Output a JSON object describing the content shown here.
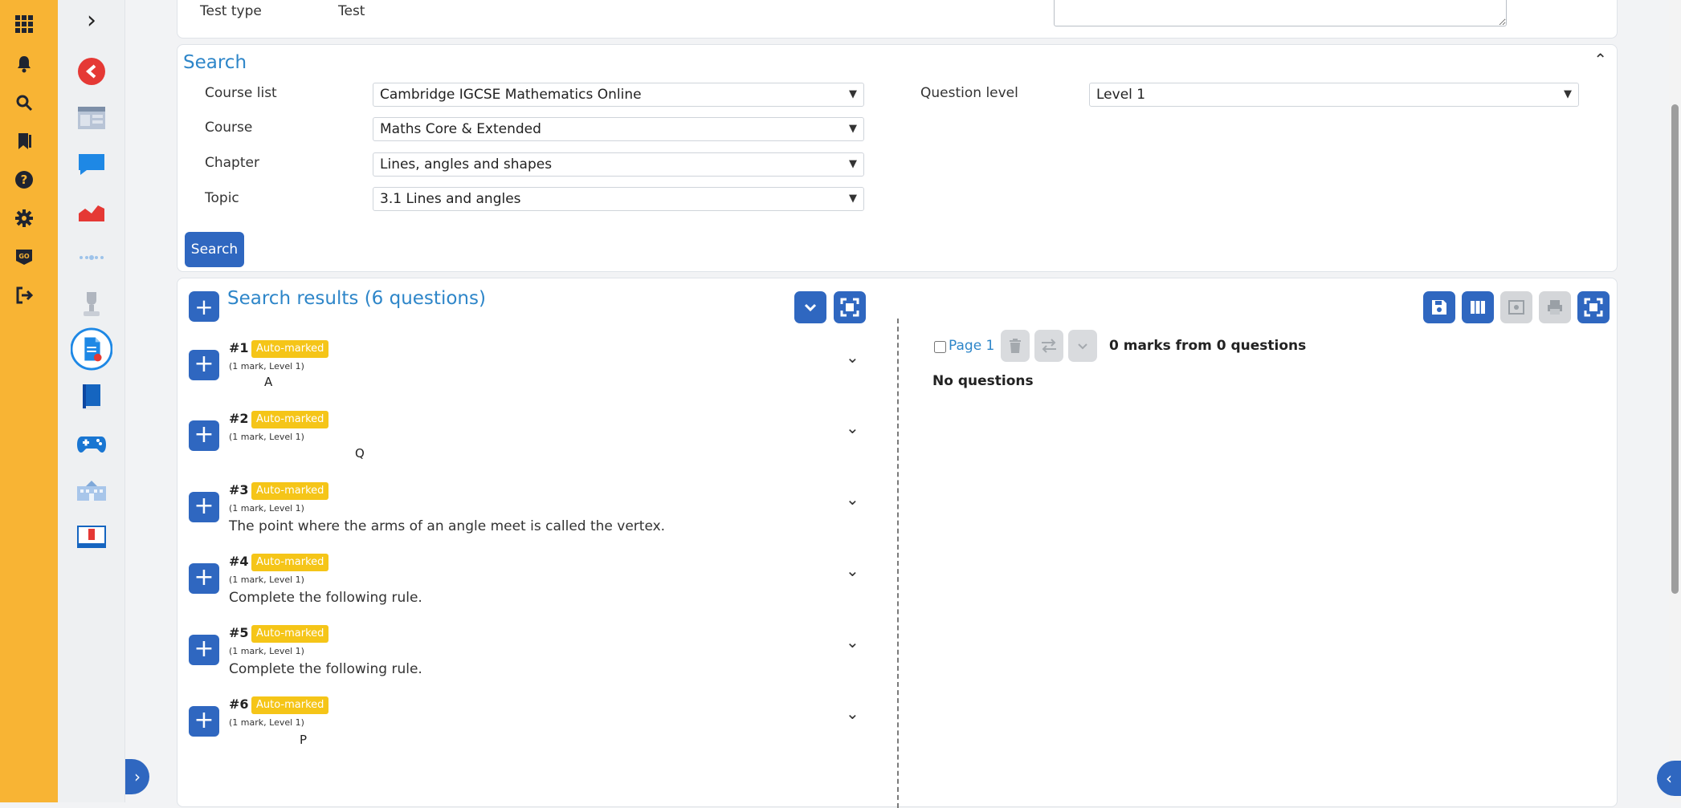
{
  "rail": {
    "icons": [
      "apps-grid-icon",
      "bell-icon",
      "search-icon",
      "bookmark-icon",
      "help-icon",
      "gear-icon",
      "go-icon",
      "logout-icon"
    ]
  },
  "nav2": {
    "icons": [
      "back-icon",
      "dashboard-icon",
      "chat-icon",
      "chart-icon",
      "progress-icon",
      "trophy-icon",
      "document-icon",
      "book-icon",
      "gamepad-icon",
      "school-icon",
      "id-card-icon"
    ]
  },
  "top": {
    "test_type_label": "Test type",
    "test_type_value": "Test"
  },
  "search": {
    "title": "Search",
    "course_list_label": "Course list",
    "course_list_value": "Cambridge IGCSE Mathematics Online",
    "course_label": "Course",
    "course_value": "Maths Core & Extended",
    "chapter_label": "Chapter",
    "chapter_value": "Lines, angles and shapes",
    "topic_label": "Topic",
    "topic_value": "3.1 Lines and angles",
    "question_level_label": "Question level",
    "question_level_value": "Level 1",
    "button": "Search"
  },
  "results": {
    "title": "Search results (6 questions)",
    "questions": [
      {
        "num": "#1",
        "badge": "Auto-marked",
        "meta": "(1 mark, Level 1)",
        "text": "",
        "glyph": "A"
      },
      {
        "num": "#2",
        "badge": "Auto-marked",
        "meta": "(1 mark, Level 1)",
        "text": "",
        "glyph": "Q"
      },
      {
        "num": "#3",
        "badge": "Auto-marked",
        "meta": "(1 mark, Level 1)",
        "text": "The point where the arms of an angle meet is called the vertex.",
        "glyph": ""
      },
      {
        "num": "#4",
        "badge": "Auto-marked",
        "meta": "(1 mark, Level 1)",
        "text": "Complete the following rule.",
        "glyph": ""
      },
      {
        "num": "#5",
        "badge": "Auto-marked",
        "meta": "(1 mark, Level 1)",
        "text": "Complete the following rule.",
        "glyph": ""
      },
      {
        "num": "#6",
        "badge": "Auto-marked",
        "meta": "(1 mark, Level 1)",
        "text": "",
        "glyph": "P"
      }
    ]
  },
  "test_panel": {
    "page_label": "Page 1",
    "summary": "0 marks from 0 questions",
    "empty": "No questions"
  },
  "colors": {
    "rail": "#f8b434",
    "accent": "#2f67c0",
    "heading": "#2e86c9",
    "badge": "#f5c518"
  }
}
